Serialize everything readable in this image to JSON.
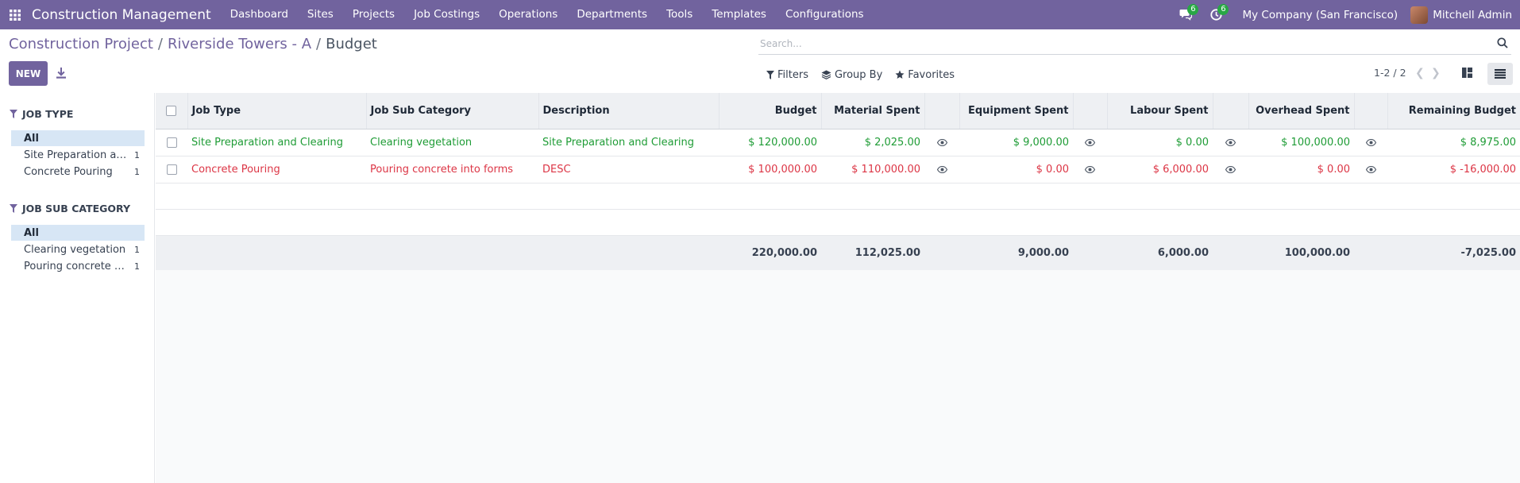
{
  "navbar": {
    "brand": "Construction Management",
    "menu": [
      "Dashboard",
      "Sites",
      "Projects",
      "Job Costings",
      "Operations",
      "Departments",
      "Tools",
      "Templates",
      "Configurations"
    ],
    "messages_count": "6",
    "activities_count": "6",
    "company": "My Company (San Francisco)",
    "user": "Mitchell Admin",
    "colors": {
      "primary": "#71639e",
      "badge": "#28a745"
    }
  },
  "breadcrumb": {
    "items": [
      "Construction Project",
      "Riverside Towers - A"
    ],
    "current": "Budget"
  },
  "toolbar": {
    "new_label": "NEW",
    "search_placeholder": "Search...",
    "filters_label": "Filters",
    "groupby_label": "Group By",
    "favorites_label": "Favorites",
    "pager": "1-2 / 2"
  },
  "sidebar": {
    "job_type": {
      "title": "JOB TYPE",
      "items": [
        {
          "label": "All",
          "count": ""
        },
        {
          "label": "Site Preparation and Clearing",
          "count": "1"
        },
        {
          "label": "Concrete Pouring",
          "count": "1"
        }
      ]
    },
    "job_sub_category": {
      "title": "JOB SUB CATEGORY",
      "items": [
        {
          "label": "All",
          "count": ""
        },
        {
          "label": "Clearing vegetation",
          "count": "1"
        },
        {
          "label": "Pouring concrete into forms",
          "count": "1"
        }
      ]
    }
  },
  "table": {
    "columns": {
      "job_type": "Job Type",
      "job_sub_category": "Job Sub Category",
      "description": "Description",
      "budget": "Budget",
      "material_spent": "Material Spent",
      "equipment_spent": "Equipment Spent",
      "labour_spent": "Labour Spent",
      "overhead_spent": "Overhead Spent",
      "remaining_budget": "Remaining Budget"
    },
    "rows": [
      {
        "status": "green",
        "job_type": "Site Preparation and Clearing",
        "job_sub_category": "Clearing vegetation",
        "description": "Site Preparation and Clearing",
        "budget": "$ 120,000.00",
        "material_spent": "$ 2,025.00",
        "equipment_spent": "$ 9,000.00",
        "labour_spent": "$ 0.00",
        "overhead_spent": "$ 100,000.00",
        "remaining_budget": "$ 8,975.00"
      },
      {
        "status": "red",
        "job_type": "Concrete Pouring",
        "job_sub_category": "Pouring concrete into forms",
        "description": "DESC",
        "budget": "$ 100,000.00",
        "material_spent": "$ 110,000.00",
        "equipment_spent": "$ 0.00",
        "labour_spent": "$ 6,000.00",
        "overhead_spent": "$ 0.00",
        "remaining_budget": "$ -16,000.00"
      }
    ],
    "totals": {
      "budget": "220,000.00",
      "material_spent": "112,025.00",
      "equipment_spent": "9,000.00",
      "labour_spent": "6,000.00",
      "overhead_spent": "100,000.00",
      "remaining_budget": "-7,025.00"
    },
    "status_colors": {
      "green": "#1f9c36",
      "red": "#dc3545"
    }
  }
}
